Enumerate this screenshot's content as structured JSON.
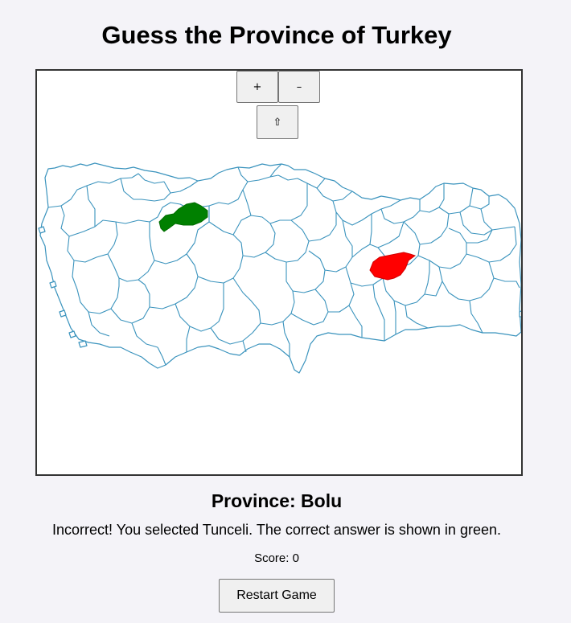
{
  "title": "Guess the Province of Turkey",
  "controls": {
    "zoom_in": "+",
    "zoom_out": "–",
    "reset_view": "⇧"
  },
  "map": {
    "highlighted": [
      {
        "name": "Bolu",
        "role": "correct-answer",
        "color": "#008000"
      },
      {
        "name": "Tunceli",
        "role": "user-selection",
        "color": "#ff0000"
      }
    ],
    "border_color": "#3a93bd"
  },
  "game": {
    "province_prefix": "Province: ",
    "province_name": "Bolu",
    "province_label": "Province: Bolu",
    "feedback": "Incorrect! You selected Tunceli. The correct answer is shown in green.",
    "score_label": "Score: 0",
    "score": 0
  },
  "buttons": {
    "restart": "Restart Game"
  }
}
